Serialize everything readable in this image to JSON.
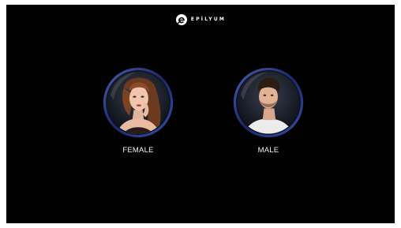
{
  "brand": {
    "name": "EPİLYUM",
    "logo_icon": "epilyum-e-logo-icon"
  },
  "gender_options": [
    {
      "label": "FEMALE",
      "icon": "female-portrait-icon"
    },
    {
      "label": "MALE",
      "icon": "male-portrait-icon"
    }
  ],
  "colors": {
    "background": "#000000",
    "ring_accent": "#2b3f8f",
    "text": "#ffffff"
  }
}
